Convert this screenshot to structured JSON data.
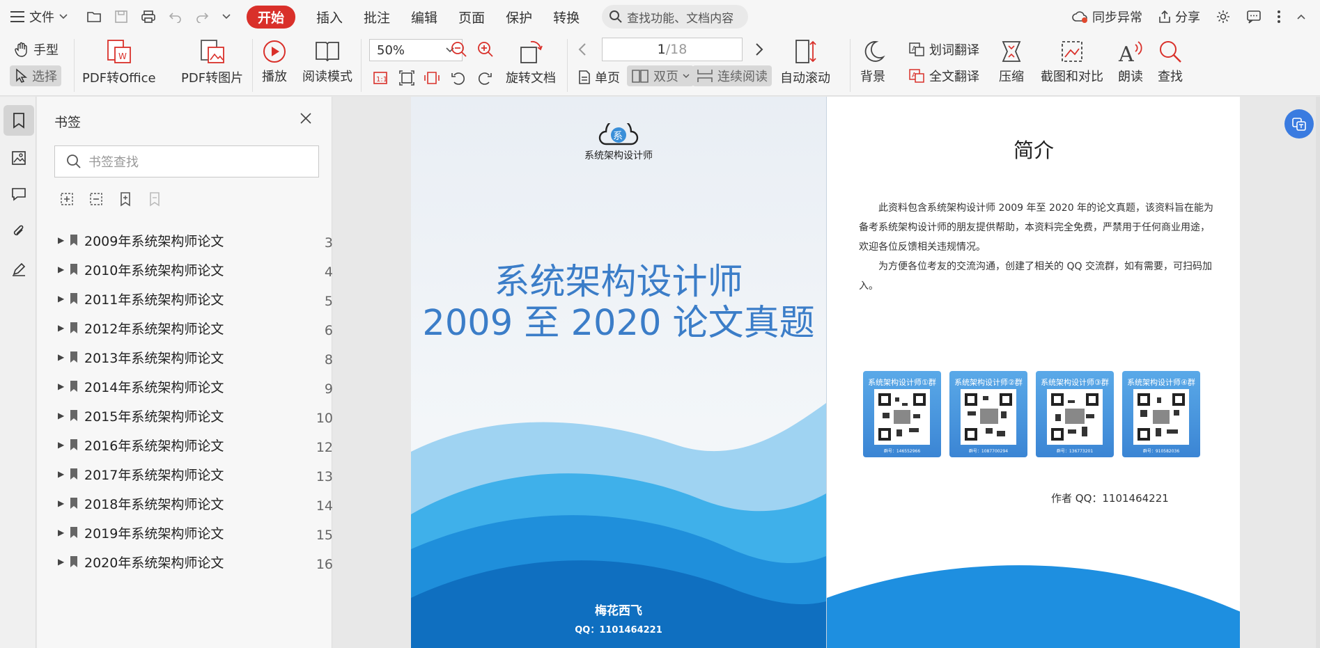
{
  "menubar": {
    "file_label": "文件",
    "tabs": [
      {
        "label": "开始"
      },
      {
        "label": "插入"
      },
      {
        "label": "批注"
      },
      {
        "label": "编辑"
      },
      {
        "label": "页面"
      },
      {
        "label": "保护"
      },
      {
        "label": "转换"
      }
    ],
    "search_placeholder": "查找功能、文档内容",
    "sync_label": "同步异常",
    "share_label": "分享"
  },
  "ribbon": {
    "hand_label": "手型",
    "select_label": "选择",
    "pdf_to_office": "PDF转Office",
    "pdf_to_image": "PDF转图片",
    "play": "播放",
    "read_mode": "阅读模式",
    "zoom": "50%",
    "rotate_doc": "旋转文档",
    "page_current": "1",
    "page_total": "/18",
    "single_page": "单页",
    "double_page": "双页",
    "continuous": "连续阅读",
    "auto_scroll": "自动滚动",
    "background": "背景",
    "word_translate": "划词翻译",
    "full_translate": "全文翻译",
    "compress": "压缩",
    "screenshot_compare": "截图和对比",
    "read_aloud": "朗读",
    "find": "查找"
  },
  "bookmarks": {
    "title": "书签",
    "search_placeholder": "书签查找",
    "items": [
      {
        "label": "2009年系统架构师论文",
        "page": "3"
      },
      {
        "label": "2010年系统架构师论文",
        "page": "4"
      },
      {
        "label": "2011年系统架构师论文",
        "page": "5"
      },
      {
        "label": "2012年系统架构师论文",
        "page": "6"
      },
      {
        "label": "2013年系统架构师论文",
        "page": "8"
      },
      {
        "label": "2014年系统架构师论文",
        "page": "9"
      },
      {
        "label": "2015年系统架构师论文",
        "page": "10"
      },
      {
        "label": "2016年系统架构师论文",
        "page": "12"
      },
      {
        "label": "2017年系统架构师论文",
        "page": "13"
      },
      {
        "label": "2018年系统架构师论文",
        "page": "14"
      },
      {
        "label": "2019年系统架构师论文",
        "page": "15"
      },
      {
        "label": "2020年系统架构师论文",
        "page": "16"
      }
    ]
  },
  "cover": {
    "logo_glyph": "系",
    "logo_text": "系统架构设计师",
    "title_line1": "系统架构设计师",
    "title_line2": "2009 至 2020 论文真题",
    "author": "梅花西飞",
    "author_qq": "QQ：1101464221"
  },
  "intro": {
    "title": "简介",
    "para1": "此资料包含系统架构设计师 2009 年至 2020 年的论文真题，该资料旨在能为备考系统架构设计师的朋友提供帮助，本资料完全免费，严禁用于任何商业用途，欢迎各位反馈相关违规情况。",
    "para2": "为方便各位考友的交流沟通，创建了相关的 QQ 交流群，如有需要，可扫码加入。",
    "qr_groups": [
      {
        "label": "系统架构设计师①群",
        "num": "群号：146552966"
      },
      {
        "label": "系统架构设计师②群",
        "num": "群号：1087700294"
      },
      {
        "label": "系统架构设计师③群",
        "num": "群号：136773201"
      },
      {
        "label": "系统架构设计师④群",
        "num": "群号：910582036"
      }
    ],
    "author_qq": "作者 QQ：1101464221"
  },
  "colors": {
    "accent": "#d9302a",
    "cover_title": "#3b7dc8",
    "float_button": "#3a7be0"
  }
}
